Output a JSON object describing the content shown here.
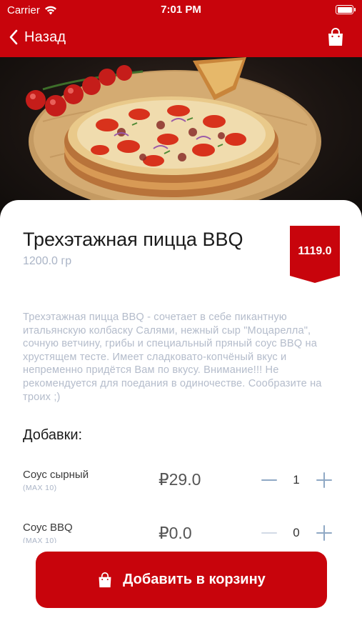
{
  "status_bar": {
    "carrier": "Carrier",
    "time": "7:01 PM"
  },
  "nav": {
    "back_label": "Назад"
  },
  "product": {
    "title": "Трехэтажная пицца BBQ",
    "weight": "1200.0 гр",
    "price": "1119.0",
    "description": "Трехэтажная  пицца BBQ - сочетает в себе пикантную итальянскую колбаску Салями, нежный сыр \"Моцарелла\", сочную ветчину, грибы и специальный пряный соус BBQ на хрустящем тесте. Имеет сладковато-копчёный вкус и непременно придётся Вам по вкусу. Внимание!!! Не рекомендуется для поедания в одиночестве. Сообразите на троих ;)"
  },
  "addons": {
    "title": "Добавки:",
    "items": [
      {
        "name": "Соус сырный",
        "max": "(MAX 10)",
        "price": "₽29.0",
        "qty": "1"
      },
      {
        "name": "Соус BBQ",
        "max": "(MAX 10)",
        "price": "₽0.0",
        "qty": "0"
      }
    ]
  },
  "add_to_cart": {
    "label": "Добавить в корзину"
  },
  "colors": {
    "brand_red": "#c8040c",
    "muted": "#b4bccb",
    "stepper": "#8fa8c4"
  },
  "icons": [
    "wifi-icon",
    "battery-icon",
    "back-chevron-icon",
    "shopping-bag-icon",
    "pizza-photo"
  ]
}
